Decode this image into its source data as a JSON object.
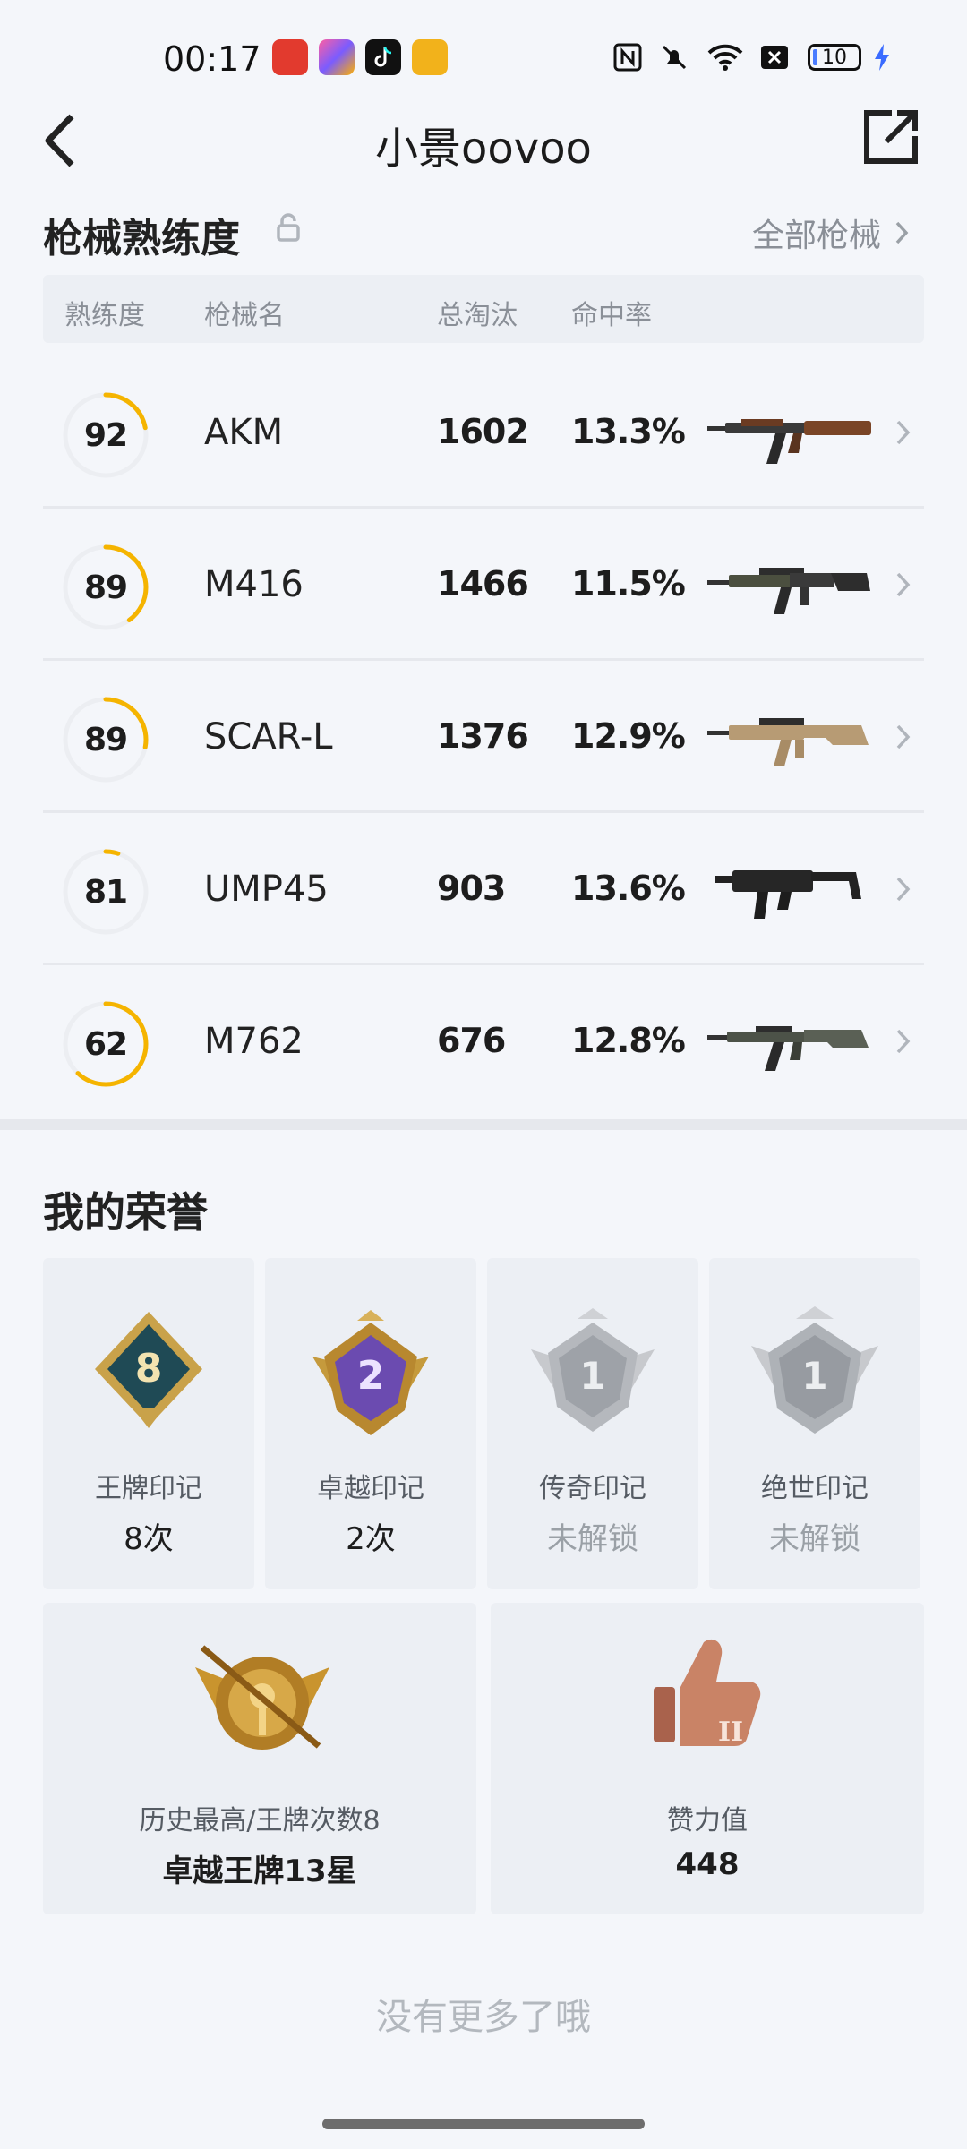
{
  "status_bar": {
    "time": "00:17",
    "battery_level": "10",
    "icons": [
      "nfc-icon",
      "mute-icon",
      "wifi-icon",
      "close-box-icon",
      "battery-icon",
      "charging-icon"
    ]
  },
  "header": {
    "title": "小景oovoo",
    "back_icon": "chevron-left-icon",
    "share_icon": "share-icon"
  },
  "weapons": {
    "section_title": "枪械熟练度",
    "all_link": "全部枪械",
    "columns": [
      "熟练度",
      "枪械名",
      "总淘汰",
      "命中率"
    ],
    "rows": [
      {
        "proficiency": "92",
        "level": 0.22,
        "name": "AKM",
        "kills": "1602",
        "hit_rate": "13.3%"
      },
      {
        "proficiency": "89",
        "level": 0.4,
        "name": "M416",
        "kills": "1466",
        "hit_rate": "11.5%"
      },
      {
        "proficiency": "89",
        "level": 0.28,
        "name": "SCAR-L",
        "kills": "1376",
        "hit_rate": "12.9%"
      },
      {
        "proficiency": "81",
        "level": 0.05,
        "name": "UMP45",
        "kills": "903",
        "hit_rate": "13.6%"
      },
      {
        "proficiency": "62",
        "level": 0.62,
        "name": "M762",
        "kills": "676",
        "hit_rate": "12.8%"
      }
    ]
  },
  "honors": {
    "section_title": "我的荣誉",
    "marks": [
      {
        "label": "王牌印记",
        "value": "8次",
        "locked": false
      },
      {
        "label": "卓越印记",
        "value": "2次",
        "locked": false
      },
      {
        "label": "传奇印记",
        "value": "未解锁",
        "locked": true
      },
      {
        "label": "绝世印记",
        "value": "未解锁",
        "locked": true
      }
    ],
    "history": {
      "label": "历史最高/王牌次数8",
      "value": "卓越王牌13星"
    },
    "likes": {
      "label": "赞力值",
      "value": "448"
    }
  },
  "footer": {
    "no_more": "没有更多了哦"
  }
}
